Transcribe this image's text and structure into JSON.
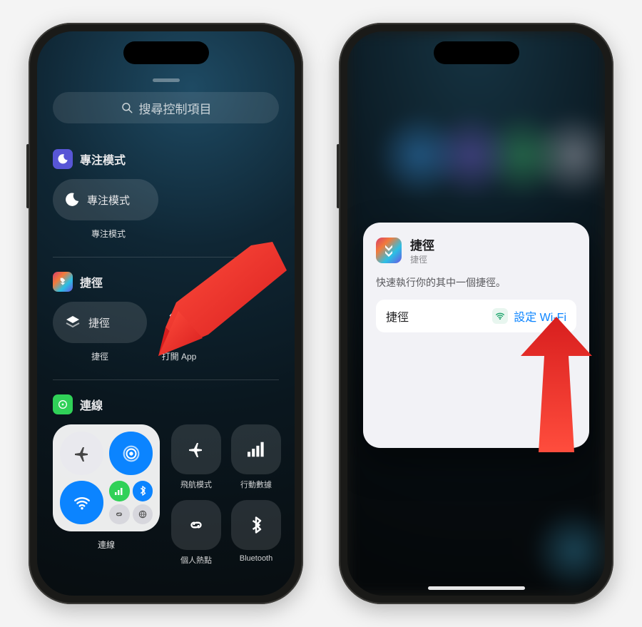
{
  "left": {
    "search_placeholder": "搜尋控制項目",
    "sections": {
      "focus": {
        "title": "專注模式",
        "tile_label": "專注模式",
        "caption": "專注模式"
      },
      "shortcuts": {
        "title": "捷徑",
        "tile_label": "捷徑",
        "caption": "捷徑",
        "open_app_caption": "打開 App"
      },
      "connect": {
        "title": "連線",
        "caption": "連線",
        "airplane": "飛航模式",
        "cellular": "行動數據",
        "hotspot": "個人熱點",
        "bluetooth": "Bluetooth"
      }
    }
  },
  "right": {
    "app_title": "捷徑",
    "app_subtitle": "捷徑",
    "description": "快速執行你的其中一個捷徑。",
    "action_label": "捷徑",
    "action_value": "設定 Wi-Fi"
  },
  "colors": {
    "accent_blue": "#0b84ff",
    "wifi_green": "#34c759"
  }
}
